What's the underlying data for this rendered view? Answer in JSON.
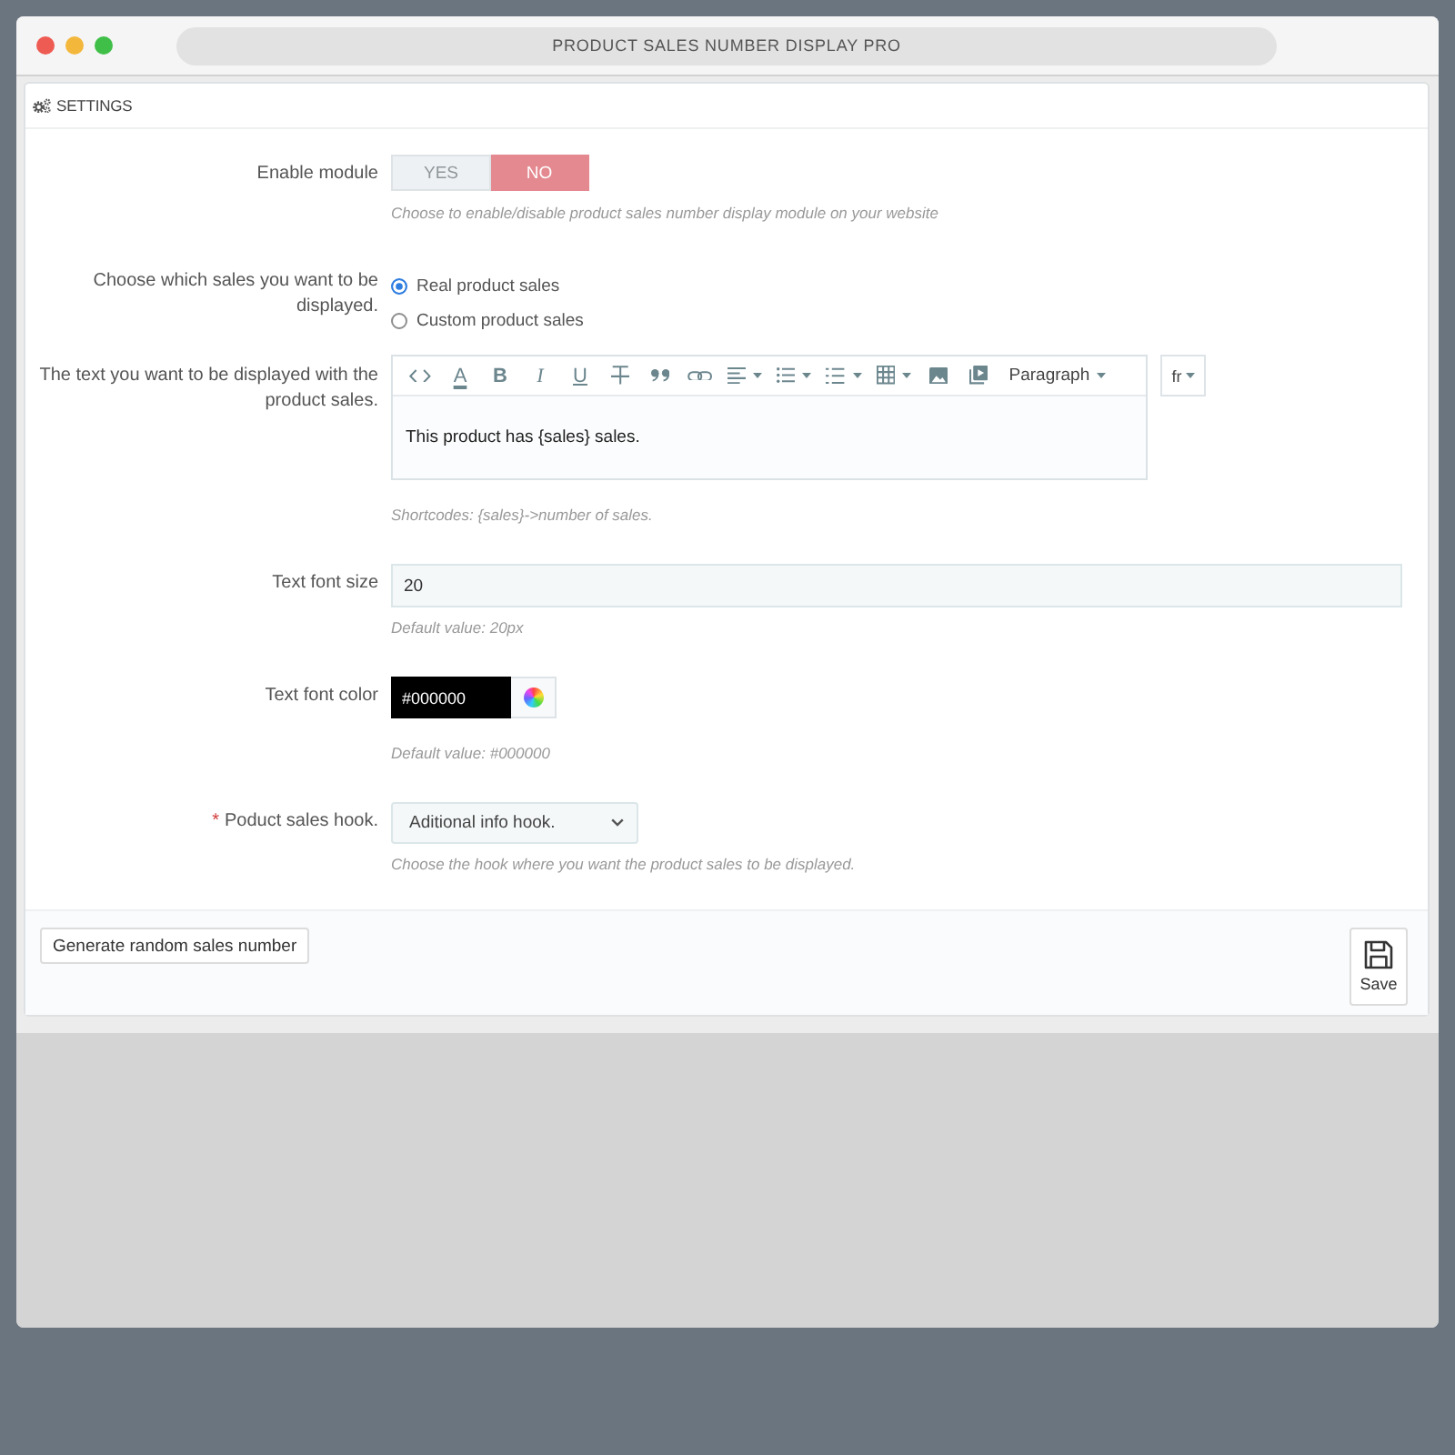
{
  "window": {
    "title": "PRODUCT SALES NUMBER DISPLAY PRO"
  },
  "panel": {
    "title": "SETTINGS"
  },
  "fields": [
    {
      "kind": "switch",
      "label": "Enable module",
      "options": [
        {
          "label": "YES",
          "selected": false
        },
        {
          "label": "NO",
          "selected": true
        }
      ],
      "help": "Choose to enable/disable product sales number display module on your website"
    },
    {
      "kind": "radio",
      "label": "Choose which sales you want to be displayed.",
      "options": [
        {
          "label": "Real product sales",
          "selected": true
        },
        {
          "label": "Custom product sales",
          "selected": false
        }
      ]
    },
    {
      "kind": "editor",
      "label": "The text you want to be displayed with the product sales.",
      "toolbar": [
        {
          "kind": "code",
          "dropdown": false
        },
        {
          "kind": "text-color",
          "text": "A",
          "dropdown": false
        },
        {
          "kind": "bold",
          "text": "B",
          "dropdown": false
        },
        {
          "kind": "italic",
          "text": "I",
          "dropdown": false
        },
        {
          "kind": "underline",
          "text": "U",
          "dropdown": false
        },
        {
          "kind": "strikethrough",
          "dropdown": false
        },
        {
          "kind": "quote",
          "dropdown": false
        },
        {
          "kind": "link",
          "dropdown": false
        },
        {
          "kind": "align",
          "dropdown": true
        },
        {
          "kind": "bullet-list",
          "dropdown": true
        },
        {
          "kind": "numbered-list",
          "dropdown": true
        },
        {
          "kind": "table",
          "dropdown": true
        },
        {
          "kind": "image",
          "dropdown": false
        },
        {
          "kind": "media",
          "dropdown": false
        },
        {
          "kind": "format",
          "text": "Paragraph",
          "dropdown": true
        }
      ],
      "value": "This product has {sales} sales.",
      "language": "fr",
      "help": "Shortcodes: {sales}->number of sales."
    },
    {
      "kind": "text",
      "label": "Text font size",
      "value": "20",
      "help": "Default value: 20px"
    },
    {
      "kind": "color",
      "label": "Text font color",
      "value": "#000000",
      "help": "Default value: #000000"
    },
    {
      "kind": "select",
      "required_mark": "*",
      "label": "Poduct sales hook.",
      "value": "Aditional info hook.",
      "help": "Choose the hook where you want the product sales to be displayed."
    }
  ],
  "footer": {
    "buttons": [
      {
        "kind": "text",
        "label": "Generate random sales number"
      },
      {
        "kind": "save",
        "label": "Save"
      }
    ]
  }
}
